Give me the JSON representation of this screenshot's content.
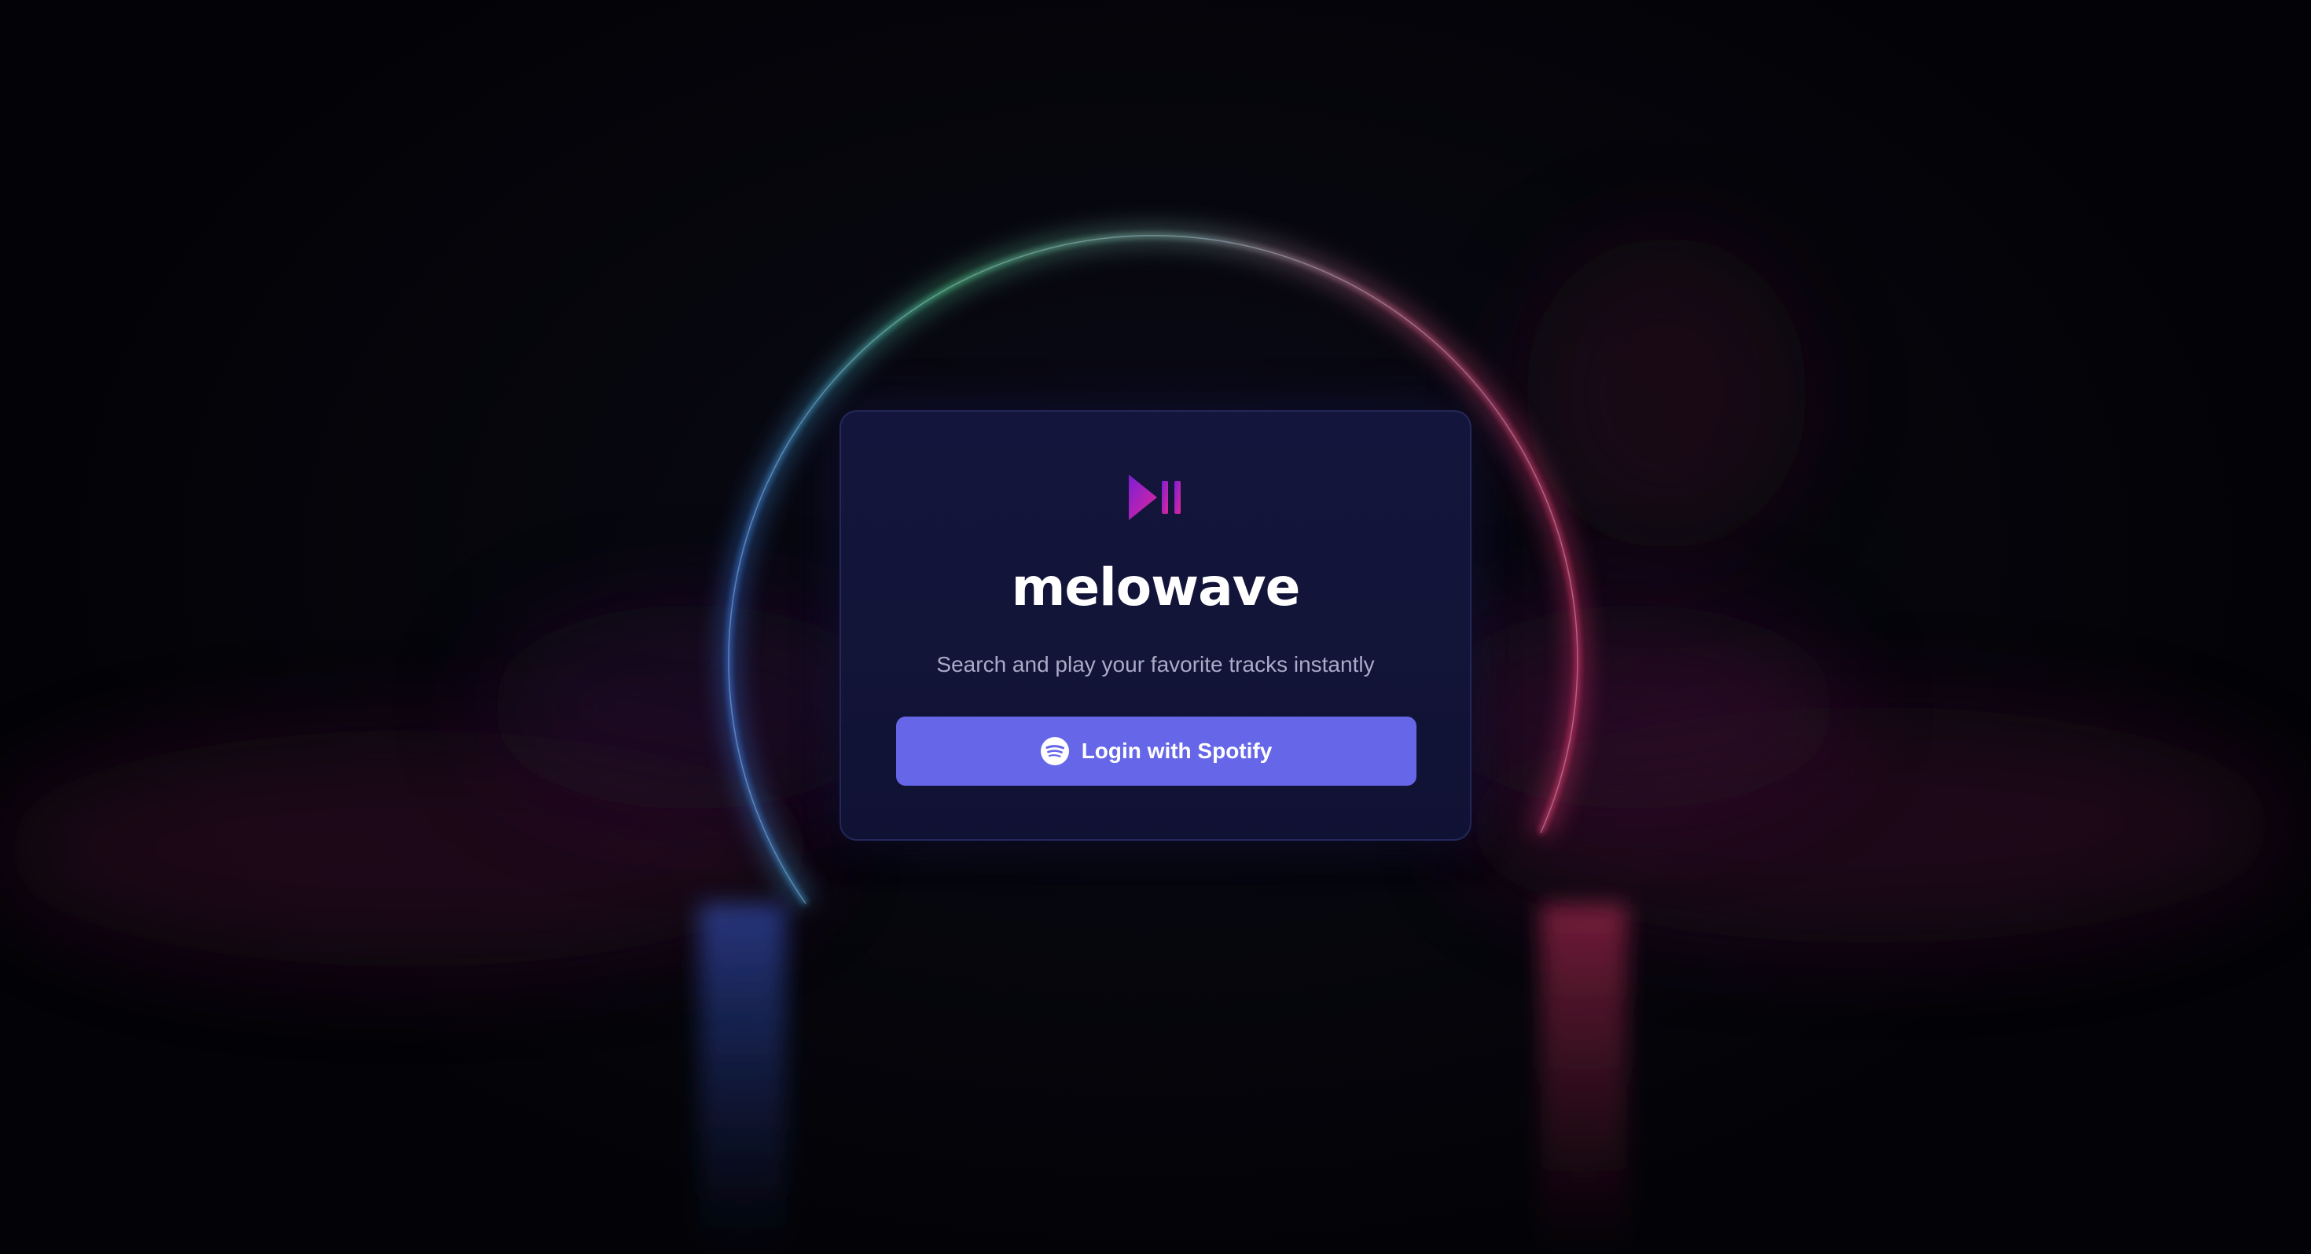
{
  "app": {
    "name": "melowave",
    "tagline": "Search and play your favorite tracks instantly"
  },
  "login": {
    "button_label": "Login with Spotify",
    "icon": "spotify-icon"
  },
  "logo": {
    "icon": "play-pause-icon"
  },
  "colors": {
    "button": "#6667e8",
    "card": "#141640",
    "logo_gradient_start": "#7b1fd6",
    "logo_gradient_end": "#e0269a",
    "ring_left": "#4fc38a",
    "ring_right": "#e0366b"
  }
}
